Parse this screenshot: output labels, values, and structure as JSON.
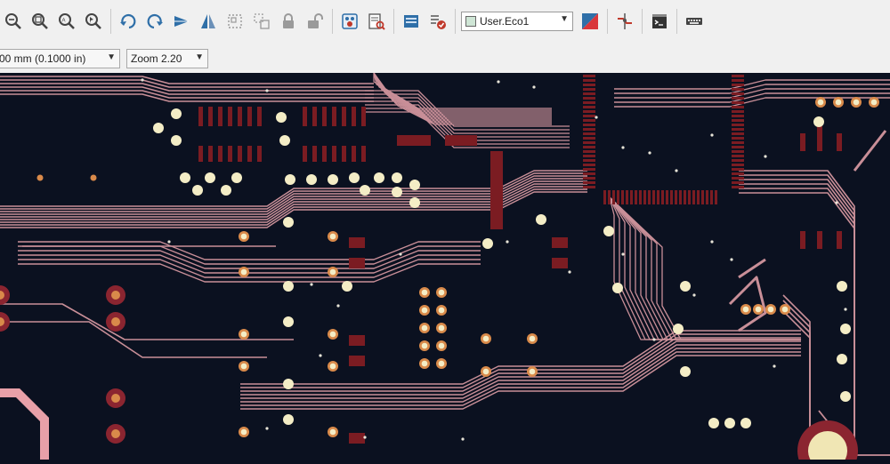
{
  "toolbar": {
    "layer_select": {
      "value": "User.Eco1"
    },
    "icons": [
      "zoom-out-icon",
      "zoom-fit-icon",
      "zoom-auto-icon",
      "zoom-selection-icon",
      "rotate-ccw-icon",
      "rotate-cw-icon",
      "mirror-horizontal-icon",
      "mirror-vertical-icon",
      "group-icon",
      "ungroup-icon",
      "lock-icon",
      "unlock-icon",
      "pad-properties-icon",
      "footprint-browser-icon",
      "netlist-icon",
      "drc-icon",
      "layer-pair-icon",
      "interactive-router-icon",
      "scripting-console-icon",
      "keyboard-icon"
    ]
  },
  "options_bar": {
    "grid_value": "00 mm (0.1000 in)",
    "zoom_value": "Zoom 2.20"
  },
  "colors": {
    "board_bg": "#0b1120",
    "trace": "#c98f98",
    "pad_smd": "#7b1c22",
    "via_ring": "#d98a4a",
    "via_hole": "#f4edc6",
    "layer_swatch": "#cfe6d6"
  }
}
